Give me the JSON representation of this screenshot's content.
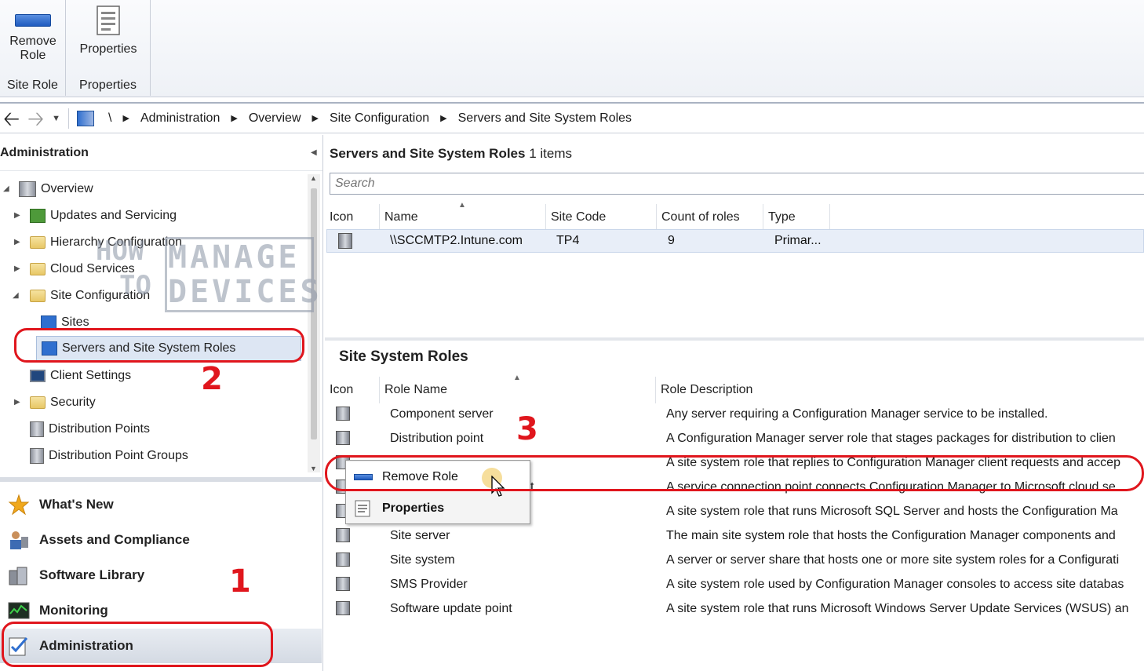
{
  "ribbon": {
    "groups": [
      {
        "button_label_1": "Remove",
        "button_label_2": "Role",
        "group_label": "Site Role",
        "icon": "remove-role-icon"
      },
      {
        "button_label": "Properties",
        "group_label": "Properties",
        "icon": "properties-icon"
      }
    ]
  },
  "address": {
    "root": "\\",
    "crumbs": [
      "Administration",
      "Overview",
      "Site Configuration",
      "Servers and Site System Roles"
    ]
  },
  "left": {
    "header": "Administration",
    "tree": [
      {
        "label": "Overview",
        "icon": "overview-icon"
      },
      {
        "label": "Updates and Servicing",
        "icon": "updates-icon"
      },
      {
        "label": "Hierarchy Configuration",
        "icon": "folder-icon"
      },
      {
        "label": "Cloud Services",
        "icon": "folder-icon"
      },
      {
        "label": "Site Configuration",
        "icon": "folder-icon"
      },
      {
        "label": "Sites",
        "icon": "sites-icon"
      },
      {
        "label": "Servers and Site System Roles",
        "icon": "servers-icon"
      },
      {
        "label": "Client Settings",
        "icon": "client-settings-icon"
      },
      {
        "label": "Security",
        "icon": "folder-icon"
      },
      {
        "label": "Distribution Points",
        "icon": "distribution-point-icon"
      },
      {
        "label": "Distribution Point Groups",
        "icon": "distribution-group-icon"
      }
    ],
    "workspaces": [
      {
        "label": "What's New",
        "icon": "star-icon"
      },
      {
        "label": "Assets and Compliance",
        "icon": "assets-icon"
      },
      {
        "label": "Software Library",
        "icon": "software-library-icon"
      },
      {
        "label": "Monitoring",
        "icon": "monitoring-icon"
      },
      {
        "label": "Administration",
        "icon": "administration-icon"
      }
    ]
  },
  "list": {
    "title": "Servers and Site System Roles",
    "count": "1 items",
    "search_placeholder": "Search",
    "columns": [
      "Icon",
      "Name",
      "Site Code",
      "Count of roles",
      "Type"
    ],
    "rows": [
      {
        "name": "\\\\SCCMTP2.Intune.com",
        "site_code": "TP4",
        "count": "9",
        "type": "Primar..."
      }
    ]
  },
  "roles": {
    "title": "Site System Roles",
    "columns": [
      "Icon",
      "Role Name",
      "Role Description"
    ],
    "rows": [
      {
        "name": "Component server",
        "desc": "Any server requiring a Configuration Manager service to be installed."
      },
      {
        "name": "Distribution point",
        "desc": "A Configuration Manager server role that stages packages for distribution to clien"
      },
      {
        "name": "",
        "desc": "A site system role that replies to Configuration Manager client requests and accep"
      },
      {
        "name": "t",
        "desc": "A service connection point connects Configuration Manager to Microsoft cloud se"
      },
      {
        "name": "",
        "desc": "A site system role that runs Microsoft SQL Server and hosts the Configuration Ma"
      },
      {
        "name": "Site server",
        "desc": "The main site system role that hosts the Configuration Manager components and"
      },
      {
        "name": "Site system",
        "desc": "A server or server share that hosts one or more site system roles for a Configurati"
      },
      {
        "name": "SMS Provider",
        "desc": "A site system role used by Configuration Manager consoles to access site databas"
      },
      {
        "name": "Software update point",
        "desc": "A site system role that runs Microsoft Windows Server Update Services (WSUS) an"
      }
    ]
  },
  "context_menu": {
    "items": [
      {
        "label": "Remove Role",
        "icon": "remove-role-icon"
      },
      {
        "label": "Properties",
        "icon": "properties-icon"
      }
    ]
  },
  "annotations": {
    "n1": "1",
    "n2": "2",
    "n3": "3"
  },
  "watermark": {
    "line1a": "HOW",
    "line1b": "MANAGE",
    "line2a": "TO",
    "line2b": "DEVICES"
  },
  "colors": {
    "annotation": "#e0161d",
    "accent": "#2f6fcf"
  }
}
